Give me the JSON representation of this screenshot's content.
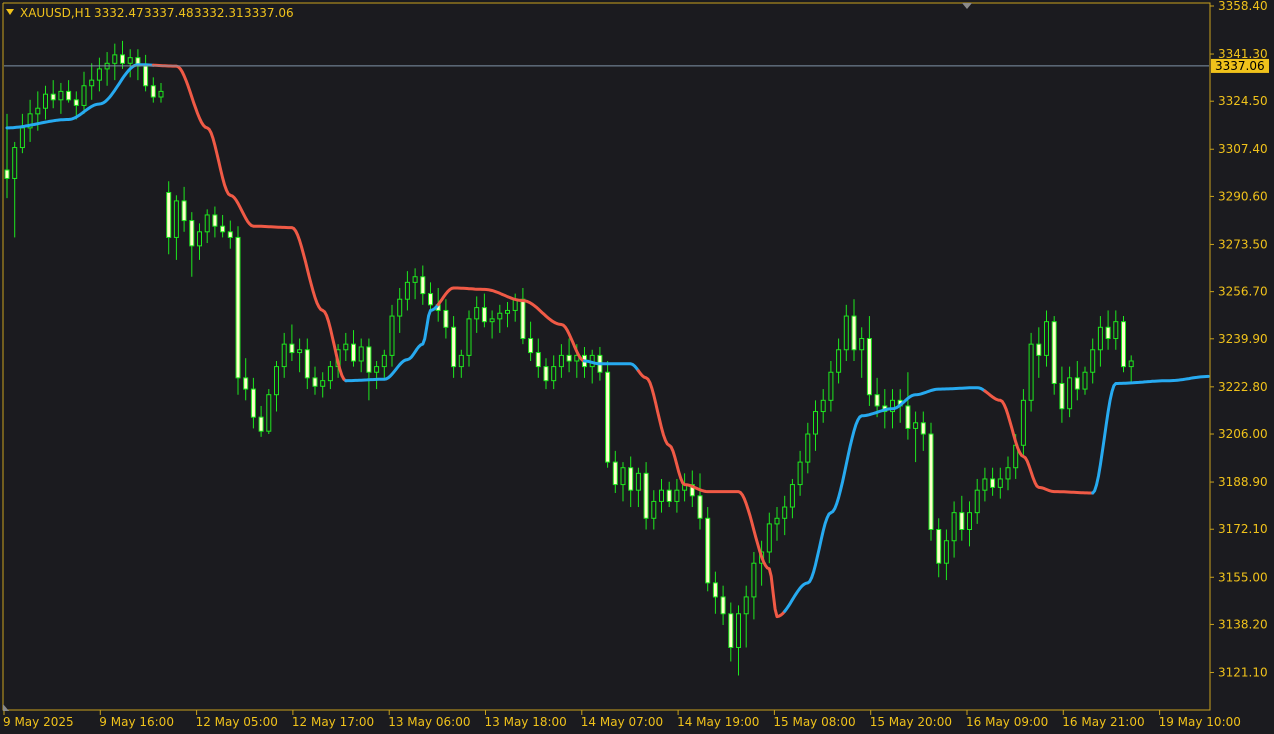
{
  "header": {
    "symbol": "XAUUSD,H1",
    "open": "3332.47",
    "high": "3337.48",
    "low": "3332.31",
    "close": "3337.06"
  },
  "colors": {
    "background": "#1b1b1f",
    "frame": "#c8a21c",
    "text": "#f0c21b",
    "candle": "#1ee81e",
    "candle_bull_fill": "#1b1b1f",
    "candle_bear_fill": "#ffffcc",
    "ma_up": "#27aaf0",
    "ma_down": "#f05a46",
    "bid_line": "#7f93a8",
    "bid_label_bg": "#f0c21b"
  },
  "chart_data": {
    "type": "candlestick",
    "timeframe": "H1",
    "ylim": [
      3114.5,
      3358.4
    ],
    "y_tick_labels": [
      "3358.40",
      "3341.30",
      "3324.50",
      "3307.40",
      "3290.60",
      "3273.50",
      "3256.70",
      "3239.90",
      "3222.80",
      "3206.00",
      "3188.90",
      "3172.10",
      "3155.00",
      "3138.20",
      "3121.10"
    ],
    "x_tick_labels": [
      "9 May 2025",
      "9 May 16:00",
      "12 May 05:00",
      "12 May 17:00",
      "13 May 06:00",
      "13 May 18:00",
      "14 May 07:00",
      "14 May 19:00",
      "15 May 08:00",
      "15 May 20:00",
      "16 May 09:00",
      "16 May 21:00",
      "19 May 10:00"
    ],
    "current_price": "3337.06",
    "moving_average": {
      "anchors": [
        {
          "bar": 0,
          "value": 3315.0
        },
        {
          "bar": 8,
          "value": 3318.0
        },
        {
          "bar": 12,
          "value": 3323.5
        },
        {
          "bar": 17,
          "value": 3337.5
        },
        {
          "bar": 22,
          "value": 3337.0
        },
        {
          "bar": 26,
          "value": 3315.0
        },
        {
          "bar": 29,
          "value": 3291.0
        },
        {
          "bar": 32,
          "value": 3280.0
        },
        {
          "bar": 37,
          "value": 3279.5
        },
        {
          "bar": 41,
          "value": 3250.0
        },
        {
          "bar": 44,
          "value": 3225.0
        },
        {
          "bar": 49,
          "value": 3225.5
        },
        {
          "bar": 52,
          "value": 3232.5
        },
        {
          "bar": 54,
          "value": 3238.0
        },
        {
          "bar": 55,
          "value": 3250.0
        },
        {
          "bar": 58,
          "value": 3258.0
        },
        {
          "bar": 62,
          "value": 3257.5
        },
        {
          "bar": 67,
          "value": 3253.5
        },
        {
          "bar": 72,
          "value": 3245.0
        },
        {
          "bar": 75,
          "value": 3232.0
        },
        {
          "bar": 77,
          "value": 3231.0
        },
        {
          "bar": 81,
          "value": 3231.0
        },
        {
          "bar": 83,
          "value": 3226.0
        },
        {
          "bar": 86,
          "value": 3202.0
        },
        {
          "bar": 88,
          "value": 3188.0
        },
        {
          "bar": 91,
          "value": 3185.5
        },
        {
          "bar": 95,
          "value": 3185.5
        },
        {
          "bar": 99,
          "value": 3158.0
        },
        {
          "bar": 100,
          "value": 3141.0
        },
        {
          "bar": 104,
          "value": 3153.0
        },
        {
          "bar": 107,
          "value": 3178.0
        },
        {
          "bar": 111,
          "value": 3212.5
        },
        {
          "bar": 115,
          "value": 3215.0
        },
        {
          "bar": 118,
          "value": 3220.0
        },
        {
          "bar": 121,
          "value": 3222.0
        },
        {
          "bar": 126,
          "value": 3222.5
        },
        {
          "bar": 129,
          "value": 3218.0
        },
        {
          "bar": 132,
          "value": 3198.0
        },
        {
          "bar": 134,
          "value": 3187.0
        },
        {
          "bar": 136,
          "value": 3185.5
        },
        {
          "bar": 141,
          "value": 3185.0
        },
        {
          "bar": 144,
          "value": 3224.0
        },
        {
          "bar": 151,
          "value": 3225.0
        },
        {
          "bar": 156,
          "value": 3226.5
        }
      ],
      "trend_segments": [
        {
          "from_bar": 0,
          "to_bar": 19,
          "trend": "up"
        },
        {
          "from_bar": 19,
          "to_bar": 44,
          "trend": "down"
        },
        {
          "from_bar": 44,
          "to_bar": 56,
          "trend": "up"
        },
        {
          "from_bar": 56,
          "to_bar": 75,
          "trend": "down"
        },
        {
          "from_bar": 75,
          "to_bar": 82,
          "trend": "up"
        },
        {
          "from_bar": 82,
          "to_bar": 101,
          "trend": "down"
        },
        {
          "from_bar": 101,
          "to_bar": 127,
          "trend": "up"
        },
        {
          "from_bar": 127,
          "to_bar": 141,
          "trend": "down"
        },
        {
          "from_bar": 141,
          "to_bar": 156,
          "trend": "up"
        }
      ]
    },
    "candles": [
      [
        3300.0,
        3320.0,
        3290.0,
        3297.0
      ],
      [
        3297.0,
        3310.0,
        3276.0,
        3308.0
      ],
      [
        3308.0,
        3320.0,
        3306.0,
        3315.0
      ],
      [
        3315.0,
        3325.0,
        3310.0,
        3320.0
      ],
      [
        3320.0,
        3328.0,
        3314.0,
        3322.0
      ],
      [
        3322.0,
        3330.0,
        3318.0,
        3327.0
      ],
      [
        3327.0,
        3332.0,
        3322.0,
        3325.0
      ],
      [
        3325.0,
        3331.0,
        3320.0,
        3328.0
      ],
      [
        3328.0,
        3332.0,
        3324.0,
        3325.0
      ],
      [
        3325.0,
        3328.0,
        3318.0,
        3323.0
      ],
      [
        3323.0,
        3335.0,
        3320.0,
        3330.0
      ],
      [
        3330.0,
        3338.0,
        3325.0,
        3332.0
      ],
      [
        3332.0,
        3340.0,
        3328.0,
        3336.0
      ],
      [
        3336.0,
        3342.0,
        3330.0,
        3338.0
      ],
      [
        3338.0,
        3345.0,
        3332.0,
        3341.0
      ],
      [
        3341.0,
        3346.0,
        3336.0,
        3338.0
      ],
      [
        3338.0,
        3343.0,
        3333.0,
        3340.0
      ],
      [
        3340.0,
        3343.0,
        3332.0,
        3337.0
      ],
      [
        3337.0,
        3341.0,
        3328.0,
        3330.0
      ],
      [
        3330.0,
        3333.0,
        3324.0,
        3326.0
      ],
      [
        3326.0,
        3331.0,
        3324.0,
        3328.0
      ],
      [
        3292.0,
        3296.0,
        3270.0,
        3276.0
      ],
      [
        3276.0,
        3291.0,
        3268.0,
        3289.0
      ],
      [
        3289.0,
        3294.0,
        3278.0,
        3282.0
      ],
      [
        3282.0,
        3285.0,
        3262.0,
        3273.0
      ],
      [
        3273.0,
        3281.0,
        3268.0,
        3278.0
      ],
      [
        3278.0,
        3286.0,
        3274.0,
        3284.0
      ],
      [
        3284.0,
        3287.0,
        3276.0,
        3280.0
      ],
      [
        3280.0,
        3284.0,
        3276.0,
        3278.0
      ],
      [
        3278.0,
        3282.0,
        3272.0,
        3276.0
      ],
      [
        3276.0,
        3280.0,
        3220.0,
        3226.0
      ],
      [
        3226.0,
        3233.0,
        3218.0,
        3222.0
      ],
      [
        3222.0,
        3226.0,
        3208.0,
        3212.0
      ],
      [
        3212.0,
        3216.0,
        3205.0,
        3207.0
      ],
      [
        3207.0,
        3222.0,
        3206.0,
        3220.0
      ],
      [
        3220.0,
        3232.0,
        3214.0,
        3230.0
      ],
      [
        3230.0,
        3242.0,
        3226.0,
        3238.0
      ],
      [
        3238.0,
        3245.0,
        3232.0,
        3235.0
      ],
      [
        3235.0,
        3240.0,
        3228.0,
        3236.0
      ],
      [
        3236.0,
        3240.0,
        3222.0,
        3226.0
      ],
      [
        3226.0,
        3230.0,
        3220.0,
        3223.0
      ],
      [
        3223.0,
        3228.0,
        3219.0,
        3225.0
      ],
      [
        3225.0,
        3232.0,
        3222.0,
        3230.0
      ],
      [
        3230.0,
        3238.0,
        3226.0,
        3236.0
      ],
      [
        3236.0,
        3242.0,
        3232.0,
        3238.0
      ],
      [
        3238.0,
        3243.0,
        3230.0,
        3232.0
      ],
      [
        3232.0,
        3240.0,
        3228.0,
        3237.0
      ],
      [
        3237.0,
        3240.0,
        3218.0,
        3228.0
      ],
      [
        3228.0,
        3232.0,
        3222.0,
        3230.0
      ],
      [
        3230.0,
        3236.0,
        3226.0,
        3234.0
      ],
      [
        3234.0,
        3252.0,
        3230.0,
        3248.0
      ],
      [
        3248.0,
        3258.0,
        3242.0,
        3254.0
      ],
      [
        3254.0,
        3264.0,
        3250.0,
        3260.0
      ],
      [
        3260.0,
        3265.0,
        3254.0,
        3262.0
      ],
      [
        3262.0,
        3266.0,
        3252.0,
        3256.0
      ],
      [
        3256.0,
        3260.0,
        3250.0,
        3252.0
      ],
      [
        3252.0,
        3258.0,
        3246.0,
        3250.0
      ],
      [
        3250.0,
        3254.0,
        3240.0,
        3244.0
      ],
      [
        3244.0,
        3248.0,
        3226.0,
        3230.0
      ],
      [
        3230.0,
        3236.0,
        3226.0,
        3234.0
      ],
      [
        3234.0,
        3250.0,
        3230.0,
        3247.0
      ],
      [
        3247.0,
        3255.0,
        3242.0,
        3251.0
      ],
      [
        3251.0,
        3256.0,
        3244.0,
        3246.0
      ],
      [
        3246.0,
        3250.0,
        3240.0,
        3247.0
      ],
      [
        3247.0,
        3252.0,
        3242.0,
        3249.0
      ],
      [
        3249.0,
        3253.0,
        3244.0,
        3250.0
      ],
      [
        3250.0,
        3256.0,
        3246.0,
        3254.0
      ],
      [
        3254.0,
        3258.0,
        3238.0,
        3240.0
      ],
      [
        3240.0,
        3246.0,
        3232.0,
        3235.0
      ],
      [
        3235.0,
        3240.0,
        3226.0,
        3230.0
      ],
      [
        3230.0,
        3233.0,
        3222.0,
        3225.0
      ],
      [
        3225.0,
        3234.0,
        3222.0,
        3230.0
      ],
      [
        3230.0,
        3238.0,
        3226.0,
        3234.0
      ],
      [
        3234.0,
        3240.0,
        3228.0,
        3232.0
      ],
      [
        3232.0,
        3238.0,
        3226.0,
        3234.0
      ],
      [
        3234.0,
        3237.0,
        3226.0,
        3230.0
      ],
      [
        3230.0,
        3236.0,
        3224.0,
        3234.0
      ],
      [
        3234.0,
        3237.0,
        3225.0,
        3228.0
      ],
      [
        3228.0,
        3232.0,
        3194.0,
        3196.0
      ],
      [
        3196.0,
        3200.0,
        3185.0,
        3188.0
      ],
      [
        3188.0,
        3196.0,
        3182.0,
        3194.0
      ],
      [
        3194.0,
        3198.0,
        3180.0,
        3186.0
      ],
      [
        3186.0,
        3194.0,
        3180.0,
        3192.0
      ],
      [
        3192.0,
        3196.0,
        3172.0,
        3176.0
      ],
      [
        3176.0,
        3186.0,
        3172.0,
        3182.0
      ],
      [
        3182.0,
        3190.0,
        3178.0,
        3186.0
      ],
      [
        3186.0,
        3189.0,
        3180.0,
        3182.0
      ],
      [
        3182.0,
        3190.0,
        3178.0,
        3186.0
      ],
      [
        3186.0,
        3192.0,
        3182.0,
        3188.0
      ],
      [
        3188.0,
        3193.0,
        3180.0,
        3184.0
      ],
      [
        3184.0,
        3192.0,
        3172.0,
        3176.0
      ],
      [
        3176.0,
        3180.0,
        3150.0,
        3153.0
      ],
      [
        3153.0,
        3157.0,
        3142.0,
        3148.0
      ],
      [
        3148.0,
        3152.0,
        3138.0,
        3142.0
      ],
      [
        3142.0,
        3146.0,
        3125.0,
        3130.0
      ],
      [
        3130.0,
        3145.0,
        3120.0,
        3142.0
      ],
      [
        3142.0,
        3152.0,
        3130.0,
        3148.0
      ],
      [
        3148.0,
        3164.0,
        3140.0,
        3160.0
      ],
      [
        3160.0,
        3168.0,
        3152.0,
        3164.0
      ],
      [
        3164.0,
        3178.0,
        3160.0,
        3174.0
      ],
      [
        3174.0,
        3180.0,
        3168.0,
        3176.0
      ],
      [
        3176.0,
        3184.0,
        3170.0,
        3180.0
      ],
      [
        3180.0,
        3190.0,
        3176.0,
        3188.0
      ],
      [
        3188.0,
        3200.0,
        3184.0,
        3196.0
      ],
      [
        3196.0,
        3210.0,
        3192.0,
        3206.0
      ],
      [
        3206.0,
        3218.0,
        3200.0,
        3214.0
      ],
      [
        3214.0,
        3222.0,
        3210.0,
        3218.0
      ],
      [
        3218.0,
        3232.0,
        3214.0,
        3228.0
      ],
      [
        3228.0,
        3240.0,
        3224.0,
        3236.0
      ],
      [
        3236.0,
        3252.0,
        3232.0,
        3248.0
      ],
      [
        3248.0,
        3254.0,
        3232.0,
        3236.0
      ],
      [
        3236.0,
        3244.0,
        3226.0,
        3240.0
      ],
      [
        3240.0,
        3248.0,
        3216.0,
        3220.0
      ],
      [
        3220.0,
        3226.0,
        3212.0,
        3216.0
      ],
      [
        3216.0,
        3222.0,
        3208.0,
        3214.0
      ],
      [
        3214.0,
        3222.0,
        3208.0,
        3218.0
      ],
      [
        3218.0,
        3222.0,
        3210.0,
        3216.0
      ],
      [
        3216.0,
        3228.0,
        3204.0,
        3208.0
      ],
      [
        3208.0,
        3214.0,
        3196.0,
        3210.0
      ],
      [
        3210.0,
        3214.0,
        3200.0,
        3206.0
      ],
      [
        3206.0,
        3210.0,
        3168.0,
        3172.0
      ],
      [
        3172.0,
        3176.0,
        3155.0,
        3160.0
      ],
      [
        3160.0,
        3172.0,
        3154.0,
        3168.0
      ],
      [
        3168.0,
        3182.0,
        3162.0,
        3178.0
      ],
      [
        3178.0,
        3184.0,
        3168.0,
        3172.0
      ],
      [
        3172.0,
        3182.0,
        3166.0,
        3178.0
      ],
      [
        3178.0,
        3190.0,
        3174.0,
        3186.0
      ],
      [
        3186.0,
        3194.0,
        3182.0,
        3190.0
      ],
      [
        3190.0,
        3194.0,
        3184.0,
        3187.0
      ],
      [
        3187.0,
        3194.0,
        3183.0,
        3190.0
      ],
      [
        3190.0,
        3198.0,
        3186.0,
        3194.0
      ],
      [
        3194.0,
        3206.0,
        3190.0,
        3202.0
      ],
      [
        3202.0,
        3222.0,
        3198.0,
        3218.0
      ],
      [
        3218.0,
        3242.0,
        3214.0,
        3238.0
      ],
      [
        3238.0,
        3244.0,
        3226.0,
        3234.0
      ],
      [
        3234.0,
        3250.0,
        3230.0,
        3246.0
      ],
      [
        3246.0,
        3248.0,
        3220.0,
        3224.0
      ],
      [
        3224.0,
        3230.0,
        3210.0,
        3215.0
      ],
      [
        3215.0,
        3230.0,
        3212.0,
        3226.0
      ],
      [
        3226.0,
        3232.0,
        3218.0,
        3222.0
      ],
      [
        3222.0,
        3230.0,
        3220.0,
        3228.0
      ],
      [
        3228.0,
        3240.0,
        3224.0,
        3236.0
      ],
      [
        3236.0,
        3248.0,
        3230.0,
        3244.0
      ],
      [
        3244.0,
        3250.0,
        3236.0,
        3240.0
      ],
      [
        3240.0,
        3250.0,
        3236.0,
        3246.0
      ],
      [
        3246.0,
        3248.0,
        3228.0,
        3230.0
      ],
      [
        3230.0,
        3234.0,
        3224.0,
        3232.0
      ]
    ]
  }
}
